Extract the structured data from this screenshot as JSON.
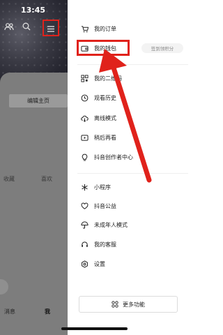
{
  "status_bar": {
    "time": "13:45"
  },
  "profile": {
    "edit_button": "编辑主页",
    "tabs": [
      "收藏",
      "喜欢"
    ],
    "bottom_nav": [
      "消息",
      "我"
    ]
  },
  "drawer": {
    "items_top": [
      {
        "label": "我的订单",
        "icon": "cart-icon"
      },
      {
        "label": "我的钱包",
        "icon": "wallet-icon"
      },
      {
        "label": "我的二维码",
        "icon": "qrcode-icon"
      },
      {
        "label": "观看历史",
        "icon": "clock-icon"
      },
      {
        "label": "离线模式",
        "icon": "cloud-download-icon"
      },
      {
        "label": "稍后再看",
        "icon": "play-later-icon"
      },
      {
        "label": "抖音创作者中心",
        "icon": "bulb-icon"
      }
    ],
    "items_bottom": [
      {
        "label": "小程序",
        "icon": "asterisk-icon"
      },
      {
        "label": "抖音公益",
        "icon": "heart-hand-icon"
      },
      {
        "label": "未成年人模式",
        "icon": "umbrella-icon"
      },
      {
        "label": "我的客服",
        "icon": "headset-icon"
      },
      {
        "label": "设置",
        "icon": "gear-icon"
      }
    ],
    "wallet_badge": "签到领积分",
    "more_button": "更多功能"
  },
  "colors": {
    "highlight": "#e0221b",
    "overlay": "#8a8a8a"
  }
}
